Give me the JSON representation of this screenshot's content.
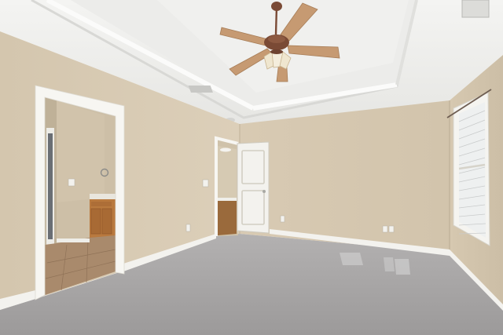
{
  "scene": {
    "subject": "empty-bedroom-interior"
  },
  "palette": {
    "wall": "#d9cbb4",
    "wall_shadow": "#cbbda5",
    "ceiling": "#f1f1ef",
    "trim": "#f7f6f2",
    "carpet": "#a8a6a6",
    "fan_wood": "#c69a72",
    "fan_bronze": "#7a4a35",
    "vanity_wood": "#b9793e",
    "tile_floor": "#a98a6c",
    "hall_floor": "#9a6a3c",
    "window_glass": "#eef0f0"
  },
  "icons": {
    "fan": "ceiling-fan-icon",
    "outlet": "outlet-icon",
    "switch": "light-switch-icon",
    "vent": "vent-icon"
  }
}
